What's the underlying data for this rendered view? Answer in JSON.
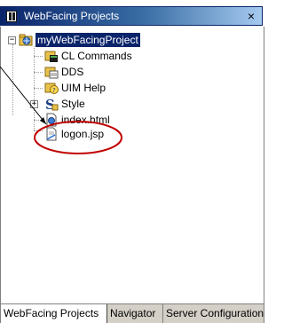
{
  "window": {
    "title": "WebFacing Projects",
    "close_label": "×"
  },
  "tree": {
    "root": {
      "label": "myWebFacingProject",
      "expander": "−"
    },
    "children": [
      {
        "label": "CL Commands",
        "icon": "cl-commands-icon"
      },
      {
        "label": "DDS",
        "icon": "dds-icon"
      },
      {
        "label": "UIM Help",
        "icon": "uim-help-icon"
      },
      {
        "label": "Style",
        "icon": "style-icon",
        "expander": "+"
      },
      {
        "label": "index.html",
        "icon": "html-file-icon"
      },
      {
        "label": "logon.jsp",
        "icon": "jsp-file-icon"
      }
    ]
  },
  "tabs": [
    {
      "label": "WebFacing Projects",
      "active": true
    },
    {
      "label": "Navigator",
      "active": false
    },
    {
      "label": "Server Configuration",
      "active": false
    }
  ],
  "colors": {
    "titlebar_start": "#0a246a",
    "titlebar_end": "#a6caf0",
    "callout": "#c00000",
    "selection": "#0a246a"
  }
}
